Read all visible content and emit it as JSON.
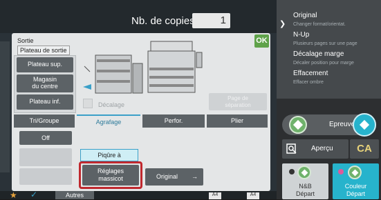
{
  "header": {
    "copies_label": "Nb. de copies",
    "copies_value": "1"
  },
  "right_panel": {
    "items": [
      {
        "title": "Original",
        "sub": "Changer format/orientat."
      },
      {
        "title": "N-Up",
        "sub": "Plusieurs pages sur une page"
      },
      {
        "title": "Décalage marge",
        "sub": "Décaler position pour marge"
      },
      {
        "title": "Effacement",
        "sub": "Effacer ombre"
      }
    ],
    "proof_label": "Epreuve",
    "preview_label": "Aperçu",
    "ca_label": "CA",
    "bw_label": "N&B\nDépart",
    "bw_line1": "N&B",
    "bw_line2": "Départ",
    "color_line1": "Couleur",
    "color_line2": "Départ"
  },
  "dialog": {
    "section_label": "Sortie",
    "tray_label": "Plateau de sortie",
    "ok_label": "OK",
    "tray_buttons": [
      "Plateau sup.",
      "Magasin\ndu centre",
      "Plateau inf."
    ],
    "tray_upper": "Plateau sup.",
    "tray_center_l1": "Magasin",
    "tray_center_l2": "du centre",
    "tray_lower": "Plateau inf.",
    "offset_label": "Décalage",
    "sep_page_l1": "Page de",
    "sep_page_l2": "séparation",
    "tabs": [
      "Tri/Groupe",
      "Agrafage",
      "Perfor.",
      "Plier"
    ],
    "active_tab": "Agrafage",
    "off_label": "Off",
    "staple_label": "Piqûre à",
    "settings_l1": "Réglages",
    "settings_l2": "massicot",
    "original_label": "Original"
  },
  "bottom": {
    "others_label": "Autres",
    "a4_label_1": "A4",
    "a4_label_2": "A4"
  },
  "colors": {
    "accent_green": "#6fb26b",
    "color_start": "#27b3cc",
    "highlight_red": "#c0282e",
    "tab_accent": "#3aa0c8"
  }
}
